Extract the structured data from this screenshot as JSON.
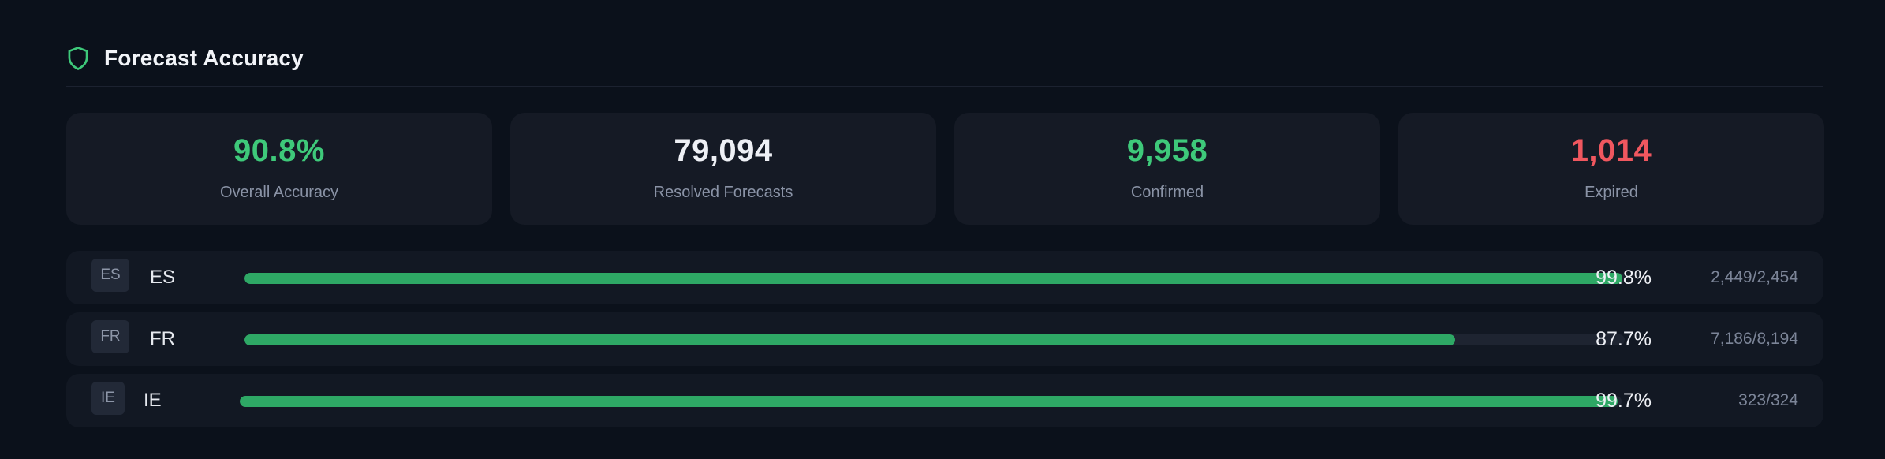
{
  "header": {
    "title": "Forecast Accuracy",
    "icon": "shield-icon",
    "accent": "#3ec97a"
  },
  "stats": [
    {
      "value": "90.8%",
      "label": "Overall Accuracy",
      "color": "#3ec97a"
    },
    {
      "value": "79,094",
      "label": "Resolved Forecasts",
      "color": "#eef0f5"
    },
    {
      "value": "9,958",
      "label": "Confirmed",
      "color": "#3ec97a"
    },
    {
      "value": "1,014",
      "label": "Expired",
      "color": "#f0575f"
    }
  ],
  "rows": [
    {
      "badge": "ES",
      "name": "ES",
      "percent": "99.8%",
      "ratio": "2,449/2,454",
      "fraction": 0.998
    },
    {
      "badge": "FR",
      "name": "FR",
      "percent": "87.7%",
      "ratio": "7,186/8,194",
      "fraction": 0.877
    },
    {
      "badge": "IE",
      "name": "IE",
      "percent": "99.7%",
      "ratio": "323/324",
      "fraction": 0.997
    }
  ],
  "colors": {
    "bar_fill": "#2ea865",
    "bar_track": "#1e2431",
    "background": "#0b111b"
  }
}
